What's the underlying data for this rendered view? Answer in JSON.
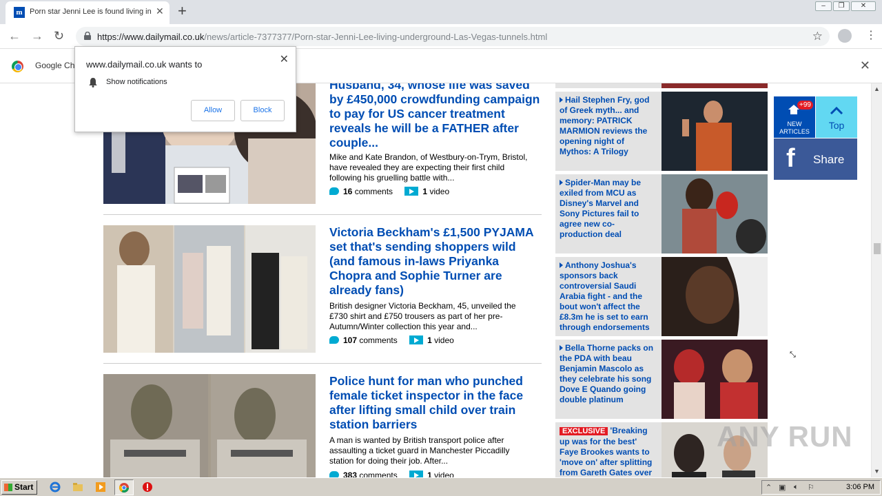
{
  "browser": {
    "tab_title": "Porn star Jenni Lee is found living in",
    "tab_favicon": "m",
    "url_host": "https://www.dailymail.co.uk",
    "url_path": "/news/article-7377377/Porn-star-Jenni-Lee-living-underground-Las-Vegas-tunnels.html",
    "infobar_text": "Google Ch"
  },
  "notification": {
    "title": "www.dailymail.co.uk wants to",
    "permission": "Show notifications",
    "allow": "Allow",
    "block": "Block"
  },
  "stories": [
    {
      "headline": "Husband, 34, whose life was saved by £450,000 crowdfunding campaign to pay for US cancer treatment reveals he will be a FATHER after couple...",
      "desc": "Mike and Kate Brandon, of Westbury-on-Trym, Bristol, have revealed they are expecting their first child following his gruelling battle with...",
      "comments_count": "16",
      "comments_label": "comments",
      "video_count": "1",
      "video_label": "video"
    },
    {
      "headline": "Victoria Beckham's £1,500 PYJAMA set that's sending shoppers wild (and famous in-laws Priyanka Chopra and Sophie Turner are already fans)",
      "desc": "British designer Victoria Beckham, 45, unveiled the £730 shirt and £750 trousers as part of her pre-Autumn/Winter collection this year and...",
      "comments_count": "107",
      "comments_label": "comments",
      "video_count": "1",
      "video_label": "video"
    },
    {
      "headline": "Police hunt for man who punched female ticket inspector in the face after lifting small child over train station barriers",
      "desc": "A man is wanted by British transport police after assaulting a ticket guard in Manchester Piccadilly station for doing their job. After...",
      "comments_count": "383",
      "comments_label": "comments",
      "video_count": "1",
      "video_label": "video"
    }
  ],
  "sidebar": [
    {
      "text": "Hail Stephen Fry, god of Greek myth... and memory: PATRICK MARMION reviews the opening night of Mythos: A Trilogy"
    },
    {
      "text": "Spider-Man may be exiled from MCU as Disney's Marvel and Sony Pictures fail to agree new co-production deal"
    },
    {
      "text": "Anthony Joshua's sponsors back controversial Saudi Arabia fight - and the bout won't affect the £8.3m he is set to earn through endorsements"
    },
    {
      "text": "Bella Thorne packs on the PDA with beau Benjamin Mascolo as they celebrate his song Dove E Quando going double platinum"
    },
    {
      "badge": "EXCLUSIVE",
      "text": "'Breaking up was for the best' Faye Brookes wants to 'move on' after splitting from Gareth Gates over"
    }
  ],
  "floating": {
    "new_badge": "+99",
    "new_label_1": "NEW",
    "new_label_2": "ARTICLES",
    "top_label": "Top",
    "share_label": "Share"
  },
  "watermark": "ANY RUN",
  "taskbar": {
    "start": "Start",
    "clock": "3:06 PM"
  },
  "colors": {
    "headline_blue": "#004db3",
    "accent_cyan": "#00aad2",
    "facebook_blue": "#3b5998",
    "top_cyan": "#62d8f2"
  }
}
